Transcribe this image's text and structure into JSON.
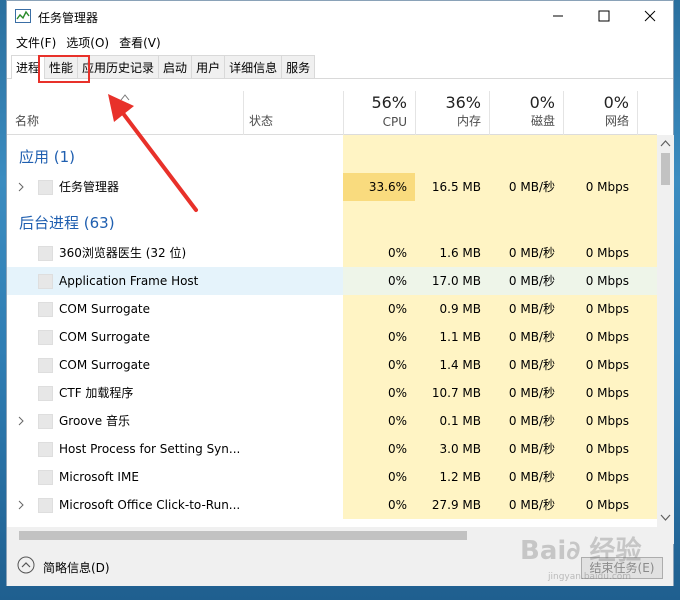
{
  "window": {
    "title": "任务管理器"
  },
  "menu": [
    "文件(F)",
    "选项(O)",
    "查看(V)"
  ],
  "tabs": [
    "进程",
    "性能",
    "应用历史记录",
    "启动",
    "用户",
    "详细信息",
    "服务"
  ],
  "columns": {
    "name": "名称",
    "status": "状态",
    "cpu": {
      "pct": "56%",
      "label": "CPU"
    },
    "memory": {
      "pct": "36%",
      "label": "内存"
    },
    "disk": {
      "pct": "0%",
      "label": "磁盘"
    },
    "network": {
      "pct": "0%",
      "label": "网络"
    }
  },
  "groups": {
    "apps": "应用 (1)",
    "background": "后台进程 (63)"
  },
  "app_rows": [
    {
      "name": "任务管理器",
      "cpu": "33.6%",
      "mem": "16.5 MB",
      "disk": "0 MB/秒",
      "net": "0 Mbps"
    }
  ],
  "bg_rows": [
    {
      "name": "360浏览器医生 (32 位)",
      "cpu": "0%",
      "mem": "1.6 MB",
      "disk": "0 MB/秒",
      "net": "0 Mbps"
    },
    {
      "name": "Application Frame Host",
      "cpu": "0%",
      "mem": "17.0 MB",
      "disk": "0 MB/秒",
      "net": "0 Mbps"
    },
    {
      "name": "COM Surrogate",
      "cpu": "0%",
      "mem": "0.9 MB",
      "disk": "0 MB/秒",
      "net": "0 Mbps"
    },
    {
      "name": "COM Surrogate",
      "cpu": "0%",
      "mem": "1.1 MB",
      "disk": "0 MB/秒",
      "net": "0 Mbps"
    },
    {
      "name": "COM Surrogate",
      "cpu": "0%",
      "mem": "1.4 MB",
      "disk": "0 MB/秒",
      "net": "0 Mbps"
    },
    {
      "name": "CTF 加载程序",
      "cpu": "0%",
      "mem": "10.7 MB",
      "disk": "0 MB/秒",
      "net": "0 Mbps"
    },
    {
      "name": "Groove 音乐",
      "cpu": "0%",
      "mem": "0.1 MB",
      "disk": "0 MB/秒",
      "net": "0 Mbps"
    },
    {
      "name": "Host Process for Setting Syn...",
      "cpu": "0%",
      "mem": "3.0 MB",
      "disk": "0 MB/秒",
      "net": "0 Mbps"
    },
    {
      "name": "Microsoft IME",
      "cpu": "0%",
      "mem": "1.2 MB",
      "disk": "0 MB/秒",
      "net": "0 Mbps"
    },
    {
      "name": "Microsoft Office Click-to-Run...",
      "cpu": "0%",
      "mem": "27.9 MB",
      "disk": "0 MB/秒",
      "net": "0 Mbps"
    }
  ],
  "footer": {
    "fewer_details": "简略信息(D)",
    "end_task": "结束任务(E)"
  },
  "watermark": {
    "text": "Bai∂ 经验",
    "url": "jingyan.baidu.com"
  },
  "colors": {
    "annotation": "#e8312a",
    "group_title": "#1f5fb0",
    "cpu_heat": "#f9db7e",
    "cell_heat": "#fff4c4"
  }
}
